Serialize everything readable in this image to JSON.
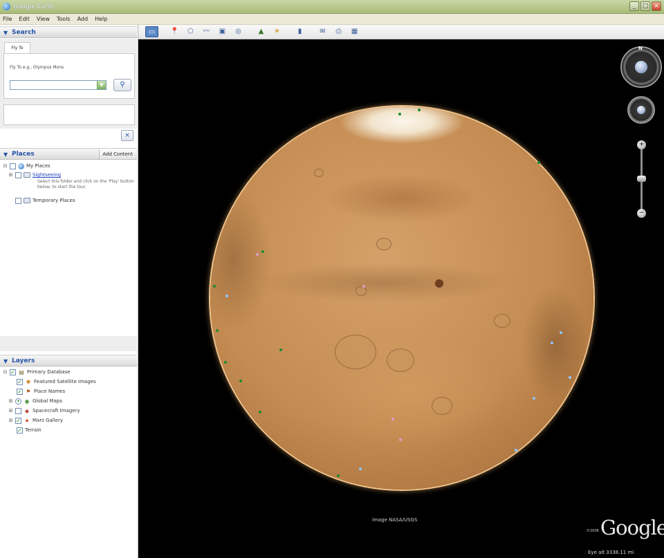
{
  "window": {
    "title": "Google Earth"
  },
  "menu": [
    "File",
    "Edit",
    "View",
    "Tools",
    "Add",
    "Help"
  ],
  "search": {
    "header": "Search",
    "tab": "Fly To",
    "label": "Fly To e.g., Olympus Mons",
    "input_value": ""
  },
  "places": {
    "header": "Places",
    "add_content": "Add Content",
    "items": [
      {
        "label": "My Places"
      },
      {
        "label": "Sightseeing",
        "note": "Select this folder and click on the 'Play' button below, to start the tour."
      },
      {
        "label": "Temporary Places"
      }
    ]
  },
  "layers": {
    "header": "Layers",
    "items": [
      {
        "label": "Primary Database"
      },
      {
        "label": "Featured Satellite Images"
      },
      {
        "label": "Place Names"
      },
      {
        "label": "Global Maps"
      },
      {
        "label": "Spacecraft Imagery"
      },
      {
        "label": "Mars Gallery"
      },
      {
        "label": "Terrain"
      }
    ]
  },
  "viewport": {
    "image_credit": "Image NASA/USGS",
    "copyright": "©2008",
    "logo": "Google",
    "eye_alt": "Eye alt  3338.11 mi"
  },
  "colors": {
    "accent": "#2553a8",
    "planet": "#c48c52",
    "background": "#000000"
  },
  "icons": {
    "toolbar": [
      "sidebar-toggle-icon",
      "placemark-icon",
      "polygon-icon",
      "path-icon",
      "image-overlay-icon",
      "record-tour-icon",
      "historical-imagery-icon",
      "sun-icon",
      "planet-switch-icon",
      "ruler-icon",
      "email-icon",
      "print-icon",
      "view-in-maps-icon"
    ]
  }
}
